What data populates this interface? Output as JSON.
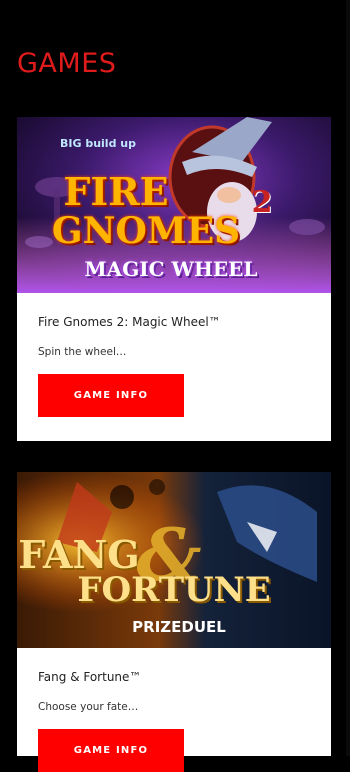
{
  "page": {
    "heading": "GAMES"
  },
  "games": [
    {
      "badge": "BIG build up",
      "art_line1": "FIRE",
      "art_line2": "GNOMES",
      "art_number": "2",
      "art_line3": "MAGIC WHEEL",
      "title": "Fire Gnomes 2: Magic Wheel™",
      "description": "Spin the wheel…",
      "button_label": "GAME INFO"
    },
    {
      "art_line1": "FANG",
      "art_amp": "&",
      "art_line2": "FORTUNE",
      "art_line3": "PRIZEDUEL",
      "title": "Fang & Fortune™",
      "description": "Choose your fate…",
      "button_label": "GAME INFO"
    }
  ],
  "colors": {
    "accent": "#ff0000",
    "heading": "#e01b1b",
    "background": "#000000"
  }
}
